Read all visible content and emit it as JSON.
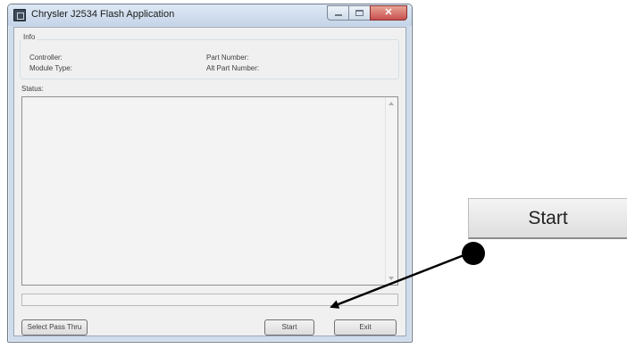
{
  "window": {
    "title": "Chrysler J2534 Flash Application",
    "icon": "app-icon",
    "controls": [
      "minimize-icon",
      "maximize-icon",
      "close-icon"
    ],
    "close_glyph": "✕"
  },
  "info": {
    "legend": "Info",
    "controller_label": "Controller:",
    "module_type_label": "Module Type:",
    "part_number_label": "Part Number:",
    "alt_part_number_label": "Alt Part Number:"
  },
  "status": {
    "label": "Status:",
    "text": ""
  },
  "progress": {
    "value": 0
  },
  "buttons": {
    "select_pass_thru": "Select Pass Thru",
    "start": "Start",
    "exit": "Exit"
  },
  "callout": {
    "zoom_label": "Start",
    "marker_color": "#000000"
  }
}
